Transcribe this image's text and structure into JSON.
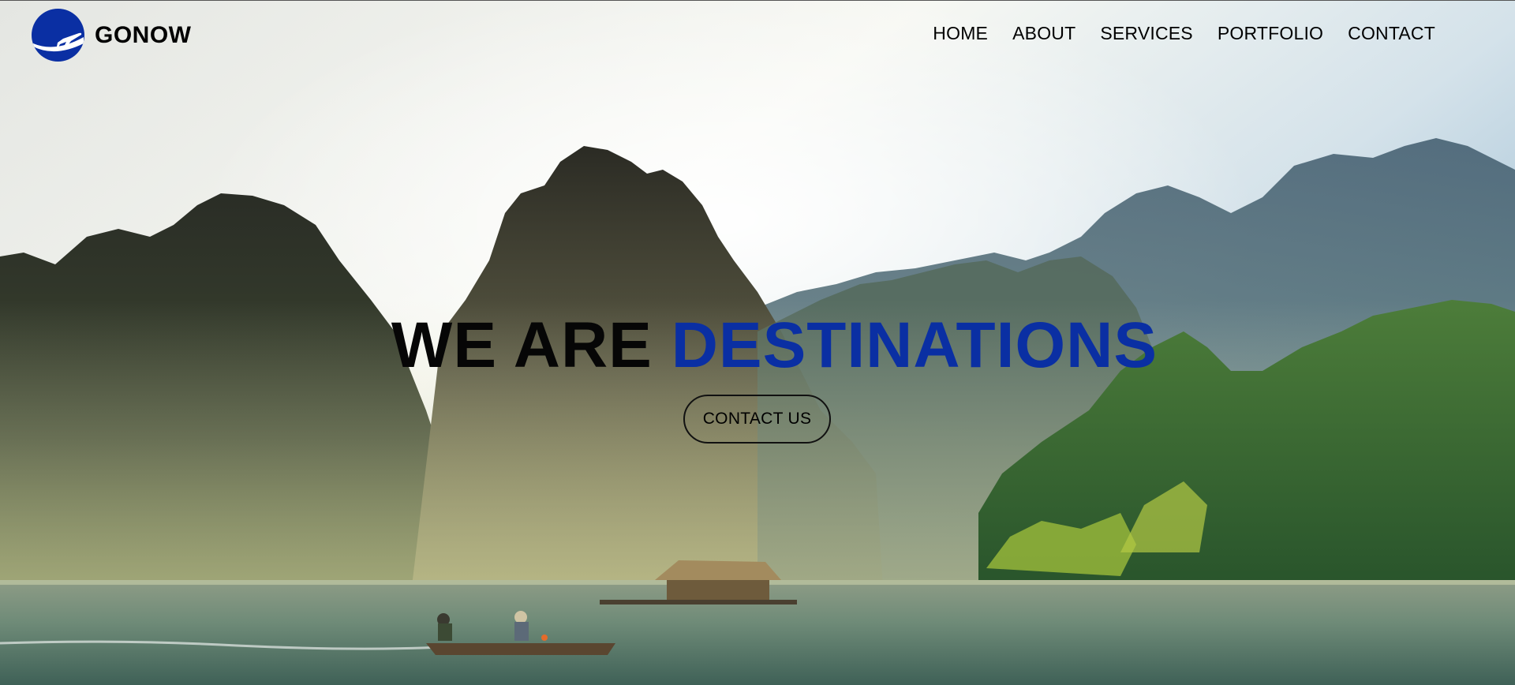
{
  "brand": {
    "name": "GONOW",
    "logo_icon": "airplane-icon",
    "logo_color": "#0a2fa3"
  },
  "nav": {
    "items": [
      {
        "label": "HOME"
      },
      {
        "label": "ABOUT"
      },
      {
        "label": "SERVICES"
      },
      {
        "label": "PORTFOLIO"
      },
      {
        "label": "CONTACT"
      }
    ]
  },
  "hero": {
    "headline_part1": "WE ARE",
    "headline_part2": "DESTINATIONS",
    "accent_color": "#0a2fa3",
    "cta_label": "CONTACT US",
    "background": "karst-mountains-river-landscape"
  }
}
